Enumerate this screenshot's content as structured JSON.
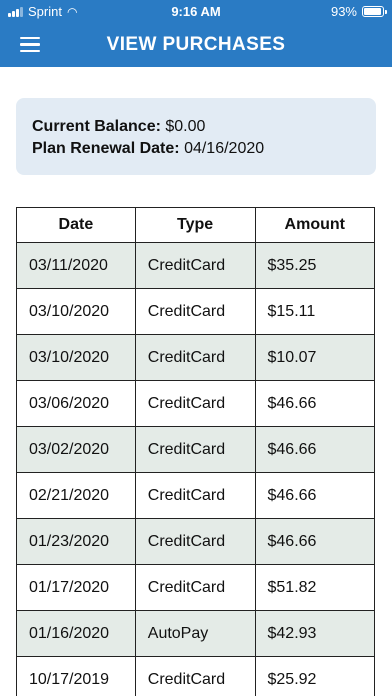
{
  "status_bar": {
    "carrier": "Sprint",
    "time": "9:16 AM",
    "battery": "93%"
  },
  "header": {
    "title": "VIEW PURCHASES"
  },
  "balance": {
    "current_label": "Current Balance:",
    "current_value": "$0.00",
    "renewal_label": "Plan Renewal Date:",
    "renewal_value": "04/16/2020"
  },
  "table": {
    "headers": [
      "Date",
      "Type",
      "Amount"
    ],
    "rows": [
      {
        "date": "03/11/2020",
        "type": "CreditCard",
        "amount": "$35.25"
      },
      {
        "date": "03/10/2020",
        "type": "CreditCard",
        "amount": "$15.11"
      },
      {
        "date": "03/10/2020",
        "type": "CreditCard",
        "amount": "$10.07"
      },
      {
        "date": "03/06/2020",
        "type": "CreditCard",
        "amount": "$46.66"
      },
      {
        "date": "03/02/2020",
        "type": "CreditCard",
        "amount": "$46.66"
      },
      {
        "date": "02/21/2020",
        "type": "CreditCard",
        "amount": "$46.66"
      },
      {
        "date": "01/23/2020",
        "type": "CreditCard",
        "amount": "$46.66"
      },
      {
        "date": "01/17/2020",
        "type": "CreditCard",
        "amount": "$51.82"
      },
      {
        "date": "01/16/2020",
        "type": "AutoPay",
        "amount": "$42.93"
      },
      {
        "date": "10/17/2019",
        "type": "CreditCard",
        "amount": "$25.92"
      }
    ]
  },
  "colors": {
    "header_bg": "#2a7bc4",
    "card_bg": "#e2ebf4",
    "row_alt_bg": "#e4ebe7"
  }
}
